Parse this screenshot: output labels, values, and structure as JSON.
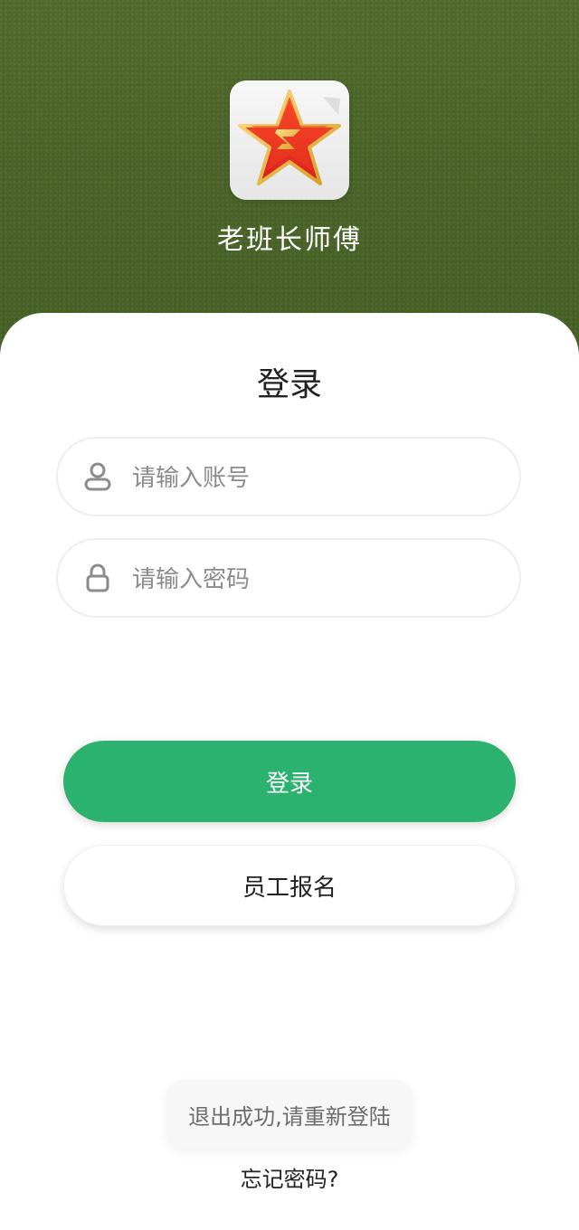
{
  "header": {
    "app_name": "老班长师傅",
    "logo_icon": "red-star-badge-icon"
  },
  "login": {
    "title": "登录",
    "account_placeholder": "请输入账号",
    "password_placeholder": "请输入密码",
    "account_icon": "user-icon",
    "password_icon": "lock-icon",
    "login_button": "登录",
    "register_button": "员工报名",
    "forgot_password": "忘记密码?"
  },
  "toast": {
    "message": "退出成功,请重新登陆"
  },
  "colors": {
    "background": "#4b6528",
    "primary": "#2bb26f",
    "card": "#ffffff"
  }
}
